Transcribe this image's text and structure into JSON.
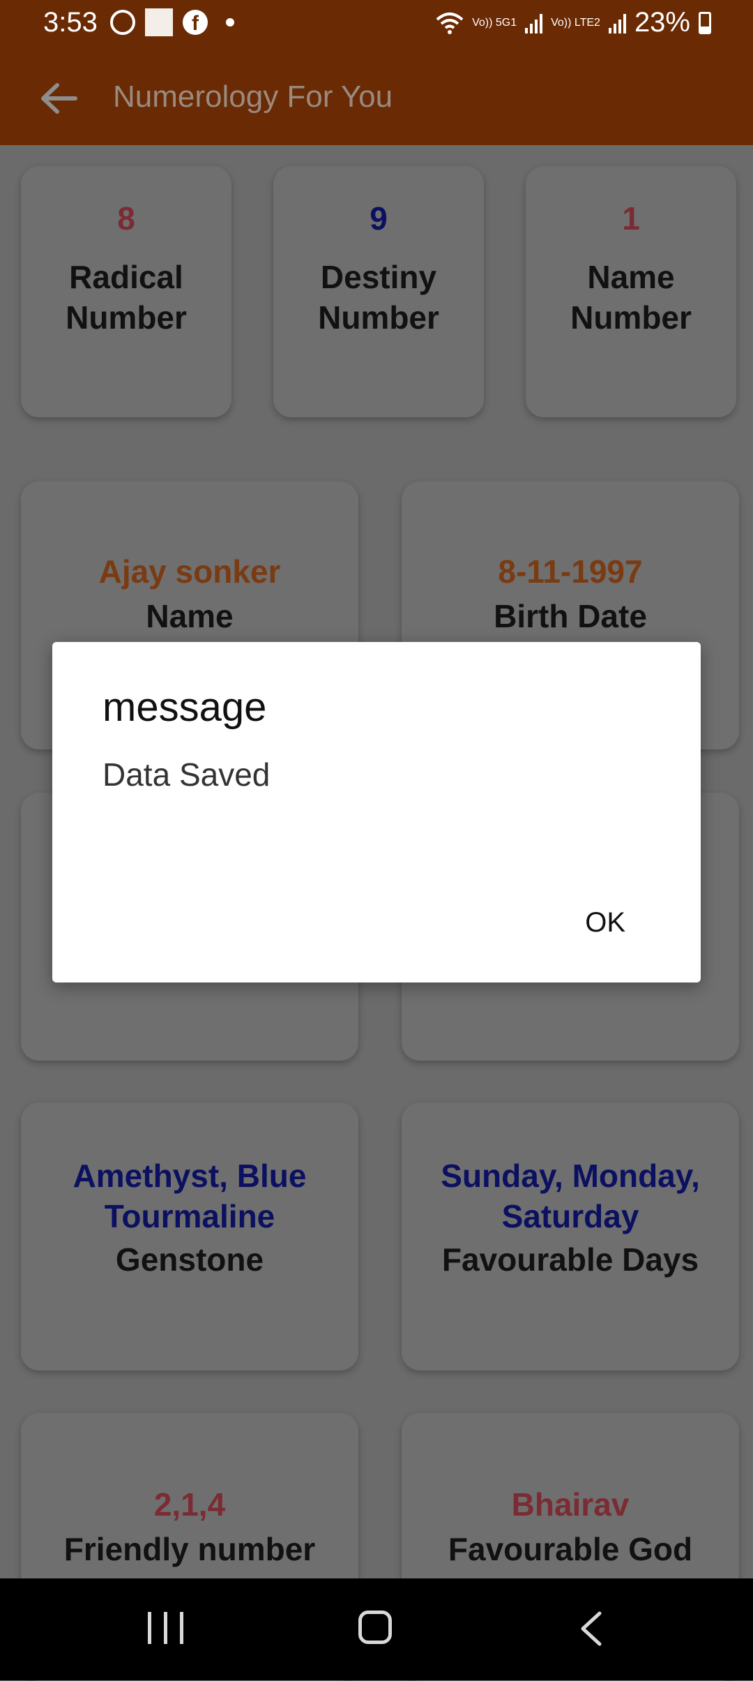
{
  "status_bar": {
    "time": "3:53",
    "left_icons": [
      "whatsapp-icon",
      "image-icon",
      "facebook-icon",
      "dot-icon"
    ],
    "network_labels": [
      "Vo)) 5G1",
      "Vo)) LTE2"
    ],
    "battery": "23%"
  },
  "app_bar": {
    "title": "Numerology For You",
    "back_icon": "back-arrow-icon"
  },
  "top_cards": [
    {
      "value": "8",
      "label_line1": "Radical",
      "label_line2": "Number",
      "value_color": "#7b2b33"
    },
    {
      "value": "9",
      "label_line1": "Destiny",
      "label_line2": "Number",
      "value_color": "#0b1060"
    },
    {
      "value": "1",
      "label_line1": "Name",
      "label_line2": "Number",
      "value_color": "#7b2b33"
    }
  ],
  "info_cards": {
    "name": {
      "value": "Ajay sonker",
      "label": "Name"
    },
    "birth_date": {
      "value": "8-11-1997",
      "label": "Birth Date"
    },
    "gemstone": {
      "value_line1": "Amethyst, Blue",
      "value_line2": "Tourmaline",
      "label": "Genstone"
    },
    "favourable_days": {
      "value_line1": "Sunday, Monday,",
      "value_line2": "Saturday",
      "label": "Favourable Days"
    },
    "friendly_number": {
      "value": "2,1,4",
      "label": "Friendly number"
    },
    "favourable_god": {
      "value": "Bhairav",
      "label": "Favourable God"
    }
  },
  "colors": {
    "brand_brown": "#6a2a03",
    "orange_value": "#7a3a12",
    "blue_value": "#0b1060",
    "red_value": "#7b2b33"
  },
  "dialog": {
    "title": "message",
    "message": "Data Saved",
    "ok_label": "OK"
  },
  "nav_bar": {
    "icons": [
      "recent-apps-icon",
      "home-icon",
      "back-icon"
    ]
  }
}
